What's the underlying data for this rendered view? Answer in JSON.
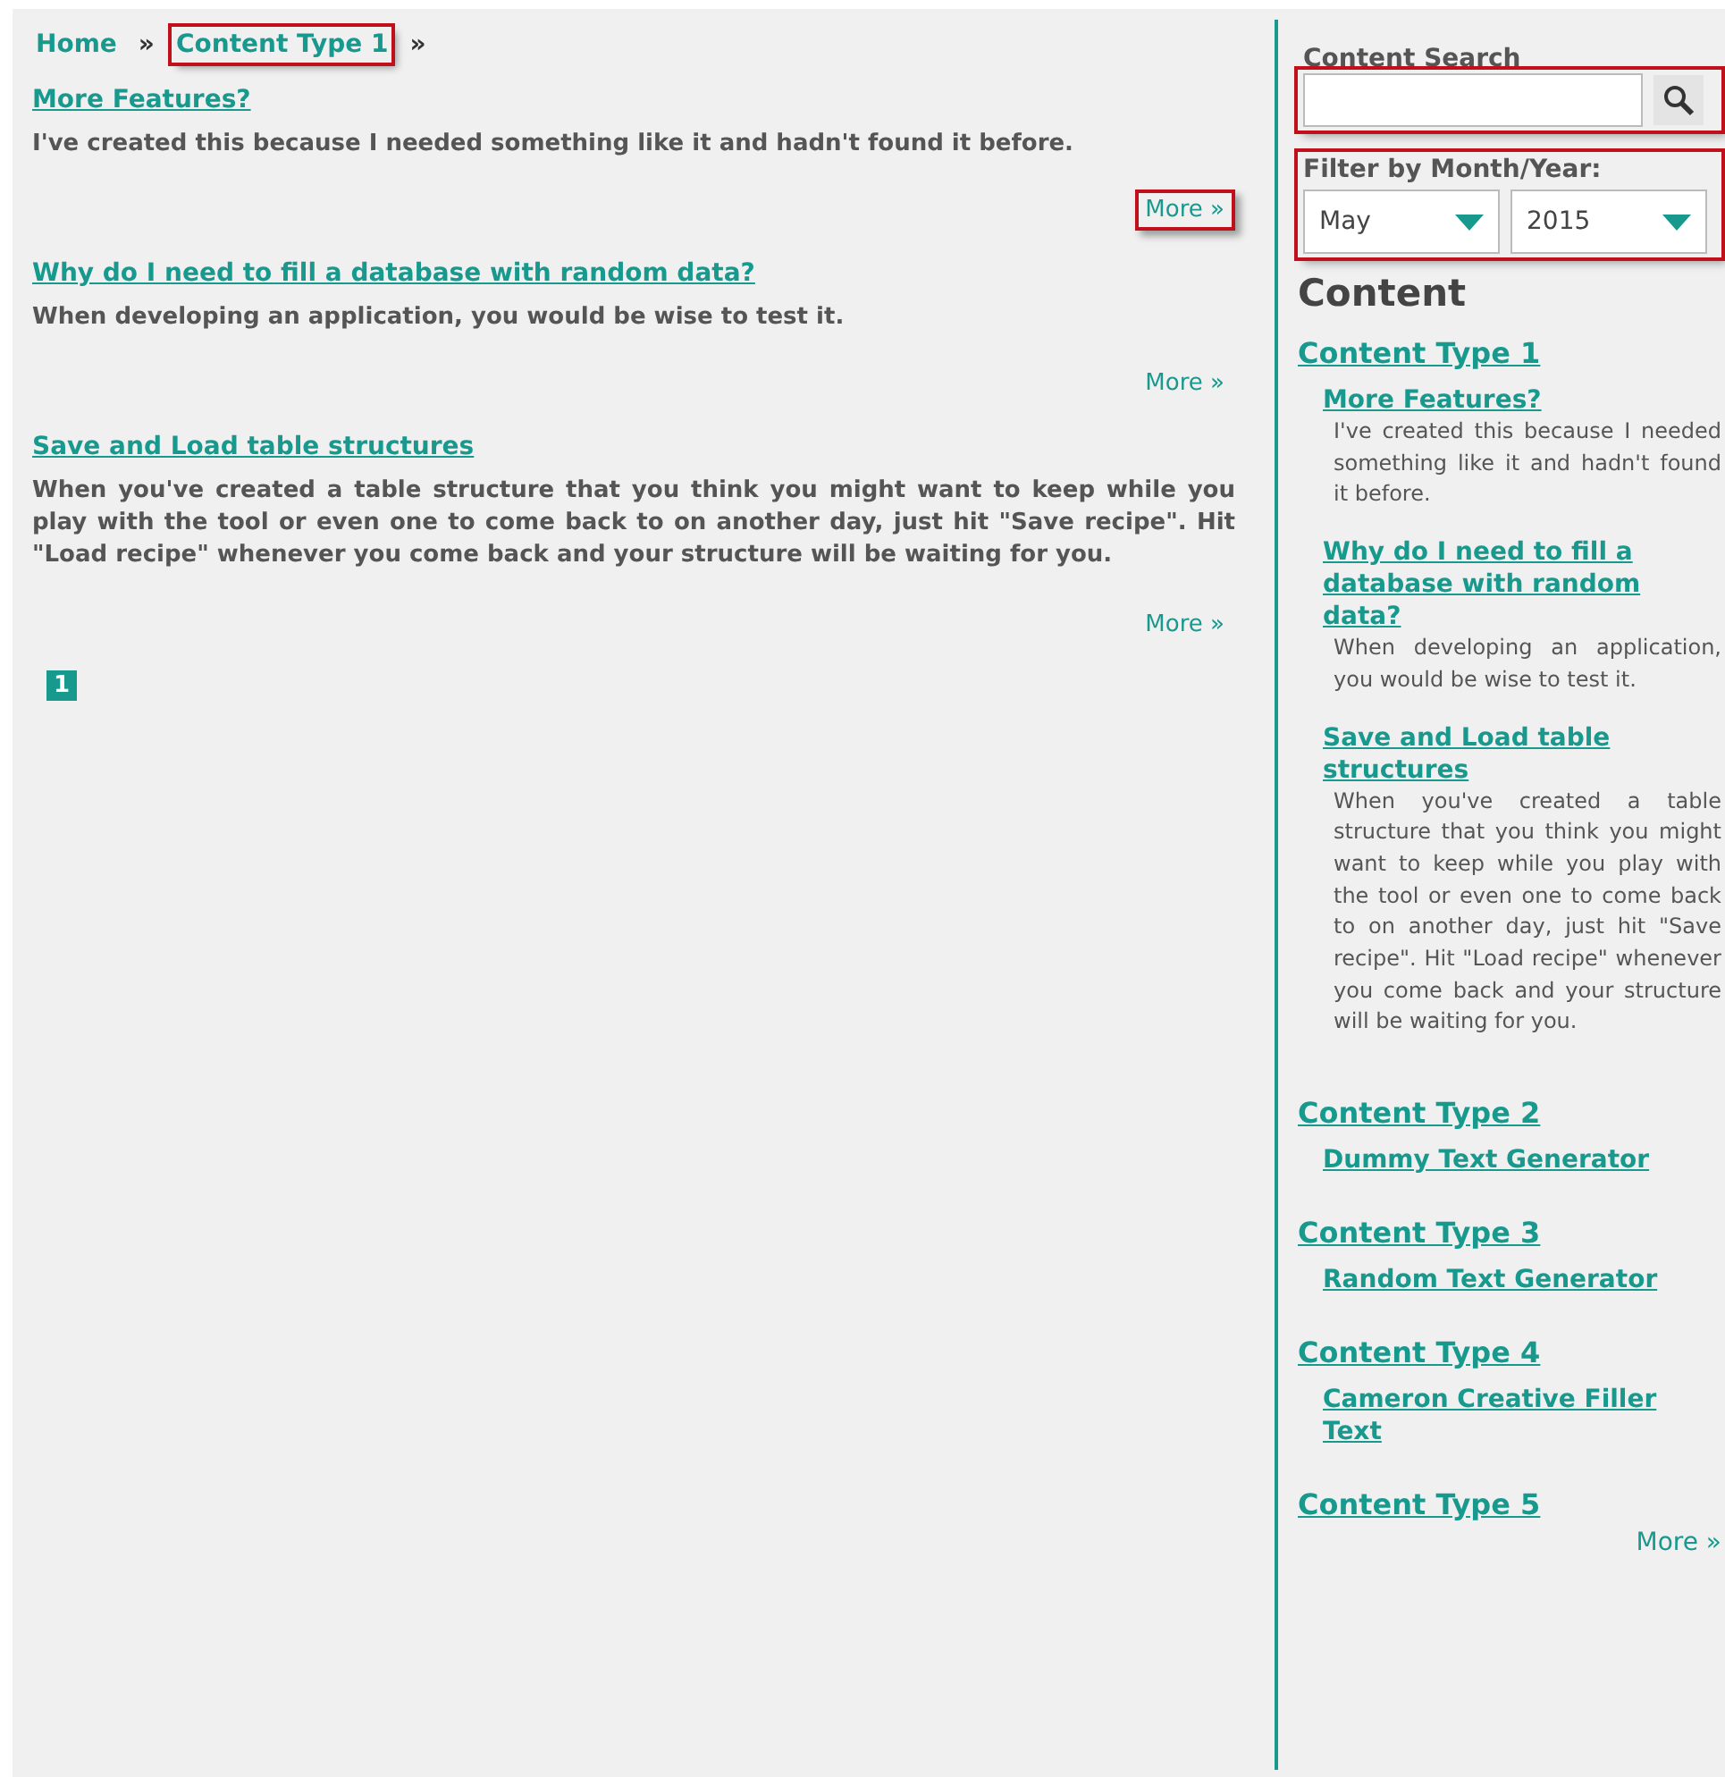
{
  "breadcrumb": [
    {
      "label": "Home",
      "kind": "link",
      "highlighted": false
    },
    {
      "label": "»",
      "kind": "separator"
    },
    {
      "label": "Content Type 1",
      "kind": "link",
      "highlighted": true
    },
    {
      "label": "»",
      "kind": "separator"
    }
  ],
  "articles": [
    {
      "title": "More Features?",
      "summary": "I've created this because I needed something like it and hadn't found it before.",
      "more": {
        "label": "More »",
        "highlighted": true
      }
    },
    {
      "title": "Why do I need to fill a database with random data?",
      "summary": "When developing an application, you would be wise to test it.",
      "more": {
        "label": "More »",
        "highlighted": false
      }
    },
    {
      "title": "Save and Load table structures",
      "summary": "When you've created a table structure that you think you might want to keep while you play with the tool or even one to come back to on another day, just hit \"Save recipe\". Hit \"Load recipe\" whenever you come back and your structure will be waiting for you.",
      "more": {
        "label": "More »",
        "highlighted": false
      }
    }
  ],
  "pagination": [
    {
      "label": "1",
      "selected": true
    }
  ],
  "sidebar": {
    "search": {
      "label": "Content Search",
      "highlighted": true
    },
    "filter": {
      "label": "Filter by Month/Year:",
      "month": "May",
      "year": "2015",
      "highlighted": true
    },
    "heading": "Content",
    "groups": [
      {
        "title": "Content Type 1",
        "items": [
          {
            "title": "More Features?",
            "summary": "I've created this because I needed something like it and hadn't found it before."
          },
          {
            "title": "Why do I need to fill a database with random data?",
            "summary": "When developing an application, you would be wise to test it."
          },
          {
            "title": "Save and Load table structures",
            "summary": "When you've created a table structure that you think you might want to keep while you play with the tool or even one to come back to on another day, just hit \"Save recipe\". Hit \"Load recipe\" whenever you come back and your structure will be waiting for you."
          }
        ]
      },
      {
        "title": "Content Type 2",
        "items": [
          {
            "title": "Dummy Text Generator"
          }
        ]
      },
      {
        "title": "Content Type 3",
        "items": [
          {
            "title": "Random Text Generator"
          }
        ]
      },
      {
        "title": "Content Type 4",
        "items": [
          {
            "title": "Cameron Creative Filler Text"
          }
        ]
      },
      {
        "title": "Content Type 5"
      }
    ],
    "more": "More »"
  }
}
